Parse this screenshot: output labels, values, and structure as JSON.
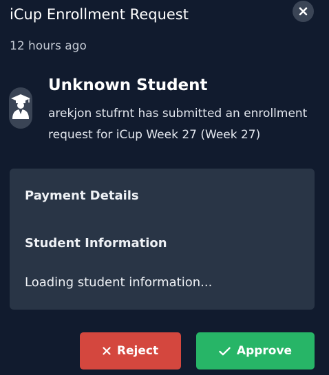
{
  "header": {
    "title": "iCup Enrollment Request",
    "close_icon": "close-icon"
  },
  "timestamp": "12 hours ago",
  "student": {
    "avatar_icon": "graduate-icon",
    "name": "Unknown Student",
    "message": "arekjon stufrnt has submitted an enrollment request for iCup Week 27 (Week 27)"
  },
  "details": {
    "payment_heading": "Payment Details",
    "student_heading": "Student Information",
    "loading_text": "Loading student information..."
  },
  "actions": {
    "reject_label": "Reject",
    "reject_icon": "x-icon",
    "approve_label": "Approve",
    "approve_icon": "check-icon"
  },
  "colors": {
    "background": "#111b2e",
    "card": "#293546",
    "reject": "#d4473e",
    "approve": "#27b567"
  }
}
